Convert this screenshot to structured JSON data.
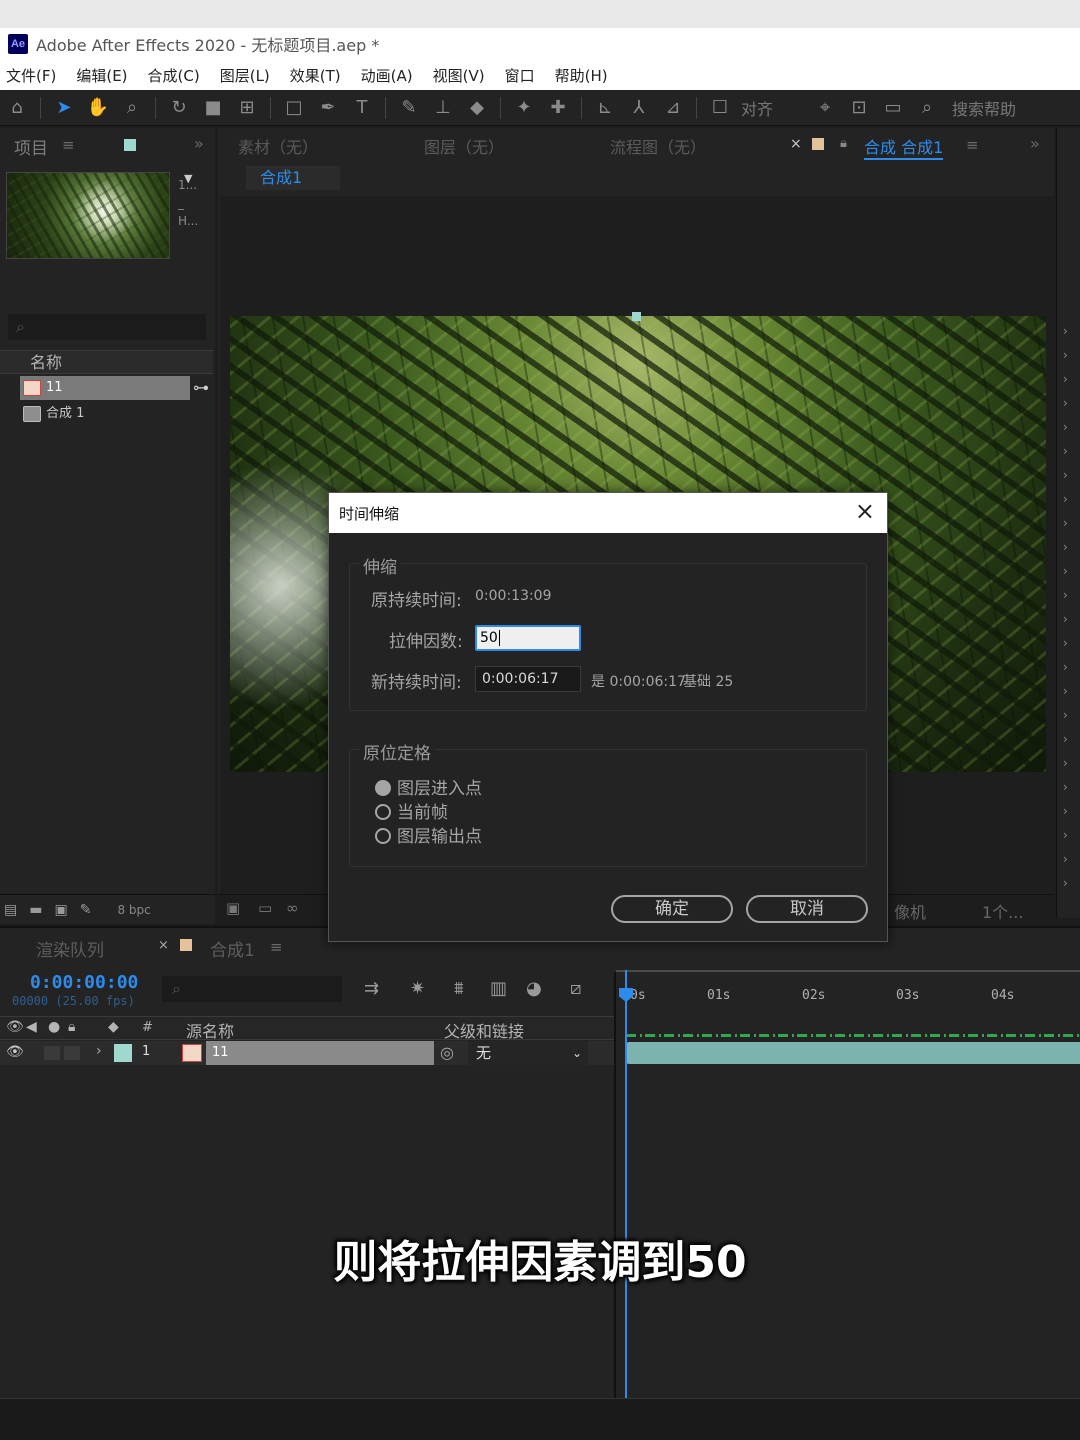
{
  "app": {
    "logo": "Ae",
    "title": "Adobe After Effects 2020 - 无标题项目.aep *"
  },
  "menu": [
    "文件(F)",
    "编辑(E)",
    "合成(C)",
    "图层(L)",
    "效果(T)",
    "动画(A)",
    "视图(V)",
    "窗口",
    "帮助(H)"
  ],
  "toolbar": {
    "align_label": "对齐",
    "search_help": "搜索帮助"
  },
  "project": {
    "tab_label": "项目",
    "thumb_meta": [
      "1...",
      "_",
      "H..."
    ],
    "column_name": "名称",
    "items": [
      {
        "name": "11",
        "type": "video",
        "selected": true
      },
      {
        "name": "合成 1",
        "type": "composition",
        "selected": false
      }
    ],
    "bpc": "8 bpc"
  },
  "composition": {
    "tabs": [
      "素材（无）",
      "图层（无）",
      "流程图（无）"
    ],
    "active_tab": "合成 合成1",
    "subtab": "合成1",
    "bottom_labels": [
      "像机",
      "1个..."
    ]
  },
  "timeline": {
    "render_tab": "渲染队列",
    "comp_tab": "合成1",
    "timecode": "0:00:00:00",
    "fps": "00000 (25.00 fps)",
    "columns": {
      "number": "#",
      "source_name": "源名称",
      "parent": "父级和链接"
    },
    "layer": {
      "index": "1",
      "name": "11",
      "parent": "无"
    },
    "ruler_ticks": [
      "0s",
      "01s",
      "02s",
      "03s",
      "04s"
    ]
  },
  "dialog": {
    "title": "时间伸缩",
    "stretch_group": "伸缩",
    "original_duration_label": "原持续时间:",
    "original_duration": "0:00:13:09",
    "stretch_factor_label": "拉伸因数:",
    "stretch_factor": "50",
    "new_duration_label": "新持续时间:",
    "new_duration": "0:00:06:17",
    "equals_text": "是 0:00:06:17",
    "base_text": "基础 25",
    "hold_group": "原位定格",
    "options": [
      "图层进入点",
      "当前帧",
      "图层输出点"
    ],
    "selected_option": 0,
    "ok_label": "确定",
    "cancel_label": "取消"
  },
  "subtitle": "则将拉伸因素调到50",
  "colors": {
    "accent": "#2d8ceb",
    "layer_bar": "#7cb3ae",
    "project_swatch": "#9fd8cf",
    "comp_swatch": "#e4c39c"
  }
}
